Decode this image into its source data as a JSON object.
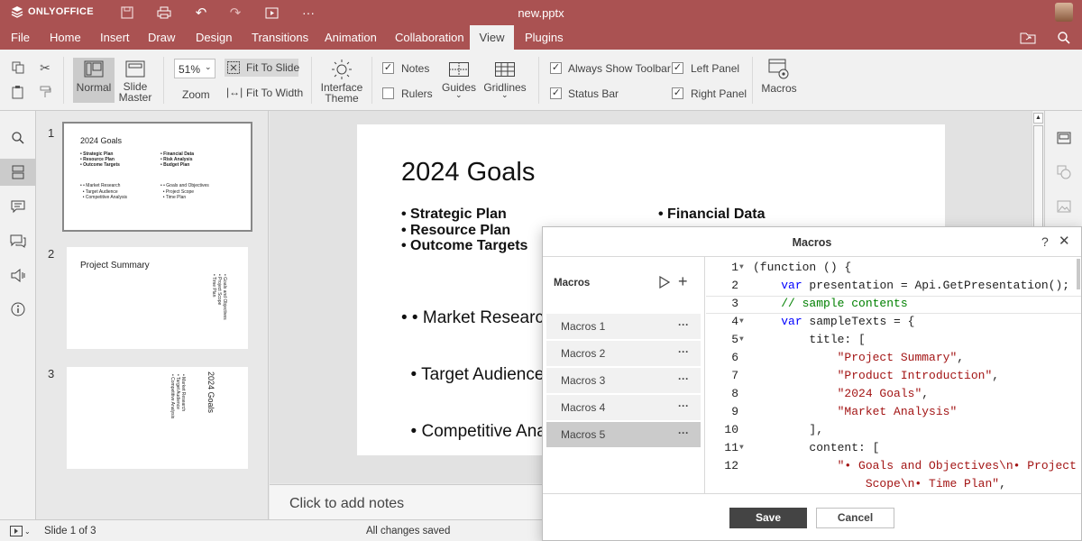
{
  "app": {
    "brand": "ONLYOFFICE",
    "filename": "new.pptx"
  },
  "menu": [
    "File",
    "Home",
    "Insert",
    "Draw",
    "Design",
    "Transitions",
    "Animation",
    "Collaboration",
    "View",
    "Plugins"
  ],
  "active_tab": "View",
  "toolbar": {
    "normal": "Normal",
    "slide_master": "Slide\nMaster",
    "zoom_value": "51%",
    "zoom_label": "Zoom",
    "fit_to_slide": "Fit To Slide",
    "fit_to_width": "Fit To Width",
    "interface_theme": "Interface\nTheme",
    "notes": "Notes",
    "rulers": "Rulers",
    "guides": "Guides",
    "gridlines": "Gridlines",
    "always_show_toolbar": "Always Show Toolbar",
    "status_bar": "Status Bar",
    "left_panel": "Left Panel",
    "right_panel": "Right Panel",
    "macros": "Macros"
  },
  "checks": {
    "notes": true,
    "rulers": false,
    "always_show_toolbar": true,
    "status_bar": true,
    "left_panel": true,
    "right_panel": true
  },
  "thumbs": [
    {
      "num": "1",
      "title": "2024 Goals",
      "col1": [
        "• Strategic Plan",
        "• Resource Plan",
        "• Outcome Targets"
      ],
      "col1b": [
        "• • Market Research",
        "  • Target Audience",
        "  • Competitive Analysis"
      ],
      "col2": [
        "• Financial Data",
        "• Risk Analysis",
        "• Budget Plan"
      ],
      "col2b": [
        "• • Goals and Objectives",
        "  • Project Scope",
        "  • Time Plan"
      ]
    },
    {
      "num": "2",
      "title": "Project Summary",
      "side": [
        "• Goals and Objectives",
        "• Project Scope",
        "• Time Plan"
      ]
    },
    {
      "num": "3",
      "title": "2024 Goals",
      "side": [
        "• Market Research",
        "• Target Audience",
        "• Competitive Analysis"
      ]
    }
  ],
  "slide": {
    "title": "2024 Goals",
    "bold_left": [
      "• Strategic Plan",
      "• Resource Plan",
      "• Outcome Targets"
    ],
    "bold_right": [
      "• Financial Data"
    ],
    "left2": [
      "• • Market Research",
      "  • Target Audience",
      "  • Competitive Analysis"
    ]
  },
  "notes_placeholder": "Click to add notes",
  "status": {
    "slide": "Slide 1 of 3",
    "saved": "All changes saved"
  },
  "dialog": {
    "title": "Macros",
    "help": "?",
    "panel_label": "Macros",
    "macros": [
      "Macros 1",
      "Macros 2",
      "Macros 3",
      "Macros 4",
      "Macros 5"
    ],
    "selected": "Macros 5",
    "more": "···",
    "save": "Save",
    "cancel": "Cancel",
    "code": [
      {
        "n": "1",
        "fold": true,
        "parts": [
          [
            "",
            "(function () {"
          ]
        ]
      },
      {
        "n": "2",
        "parts": [
          [
            "",
            "    "
          ],
          [
            "kw",
            "var"
          ],
          [
            "",
            " presentation = Api.GetPresentation();"
          ]
        ]
      },
      {
        "n": "3",
        "parts": [
          [
            "",
            "    "
          ],
          [
            "cm",
            "// sample contents"
          ]
        ]
      },
      {
        "n": "4",
        "fold": true,
        "parts": [
          [
            "",
            "    "
          ],
          [
            "kw",
            "var"
          ],
          [
            "",
            " sampleTexts = {"
          ]
        ]
      },
      {
        "n": "5",
        "fold": true,
        "parts": [
          [
            "",
            "        title: ["
          ]
        ]
      },
      {
        "n": "6",
        "parts": [
          [
            "",
            "            "
          ],
          [
            "str",
            "\"Project Summary\""
          ],
          [
            "",
            ","
          ]
        ]
      },
      {
        "n": "7",
        "parts": [
          [
            "",
            "            "
          ],
          [
            "str",
            "\"Product Introduction\""
          ],
          [
            "",
            ","
          ]
        ]
      },
      {
        "n": "8",
        "parts": [
          [
            "",
            "            "
          ],
          [
            "str",
            "\"2024 Goals\""
          ],
          [
            "",
            ","
          ]
        ]
      },
      {
        "n": "9",
        "parts": [
          [
            "",
            "            "
          ],
          [
            "str",
            "\"Market Analysis\""
          ]
        ]
      },
      {
        "n": "10",
        "parts": [
          [
            "",
            "        ],"
          ]
        ]
      },
      {
        "n": "11",
        "fold": true,
        "parts": [
          [
            "",
            "        content: ["
          ]
        ]
      },
      {
        "n": "12",
        "parts": [
          [
            "",
            "            "
          ],
          [
            "str",
            "\"• Goals and Objectives\\n• Project"
          ]
        ]
      },
      {
        "n": "",
        "parts": [
          [
            "",
            "                "
          ],
          [
            "str",
            "Scope\\n• Time Plan\""
          ],
          [
            "",
            ","
          ]
        ]
      }
    ]
  }
}
